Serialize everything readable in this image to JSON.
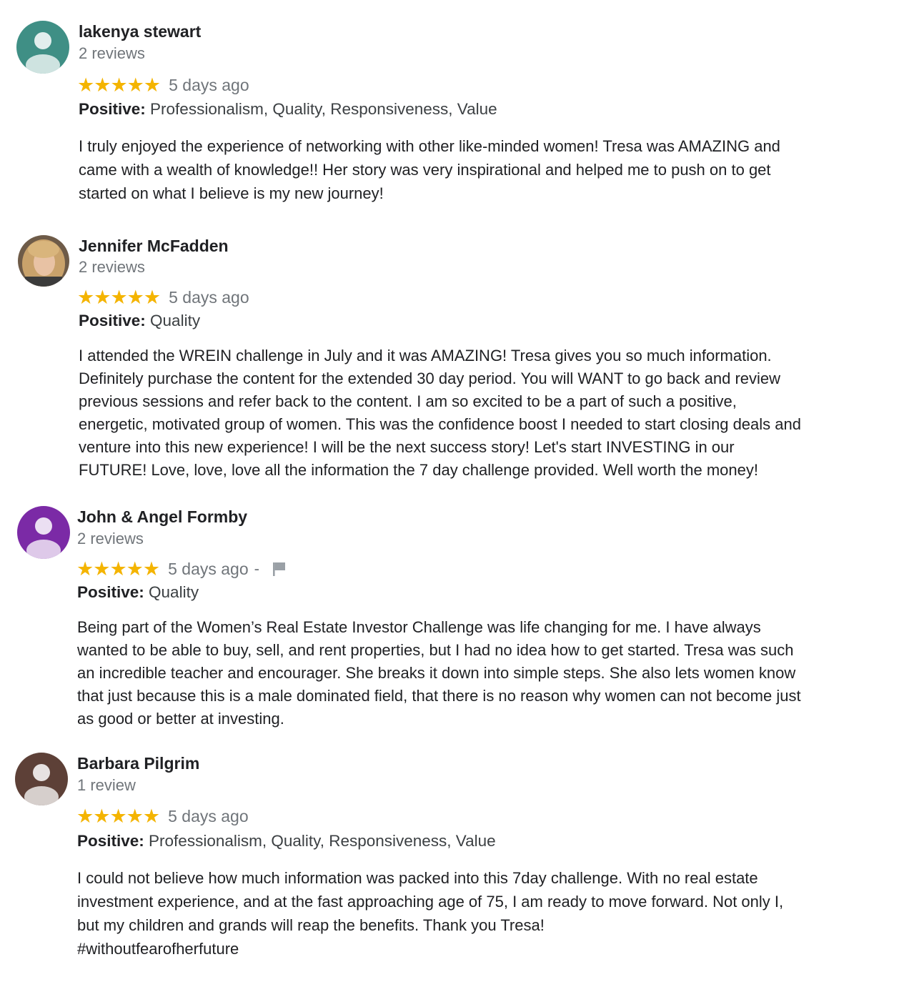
{
  "reviews": [
    {
      "author": "lakenya stewart",
      "review_count": "2 reviews",
      "stars": 5,
      "time": "5 days ago",
      "positive_label": "Positive:",
      "positive_values": "Professionalism, Quality, Responsiveness, Value",
      "avatar_color": "#3f8f85",
      "body_lines": [
        "I truly enjoyed the experience of networking with other like-minded women! Tresa was AMAZING and",
        "came with a wealth of knowledge!! Her story was very inspirational and helped me to push on to get",
        "started on what I believe is my new journey!"
      ]
    },
    {
      "author": "Jennifer McFadden",
      "review_count": "2 reviews",
      "stars": 5,
      "time": "5 days ago",
      "positive_label": "Positive:",
      "positive_values": "Quality",
      "avatar_color": "#8a6a4a",
      "body_lines": [
        "I attended the WREIN challenge in July and it was AMAZING!  Tresa gives you so much information.",
        "Definitely purchase the content for the extended 30 day period.  You will WANT to go back and review",
        "previous sessions and refer back to the content.  I am so excited to be a part of such a positive,",
        "energetic, motivated group of women.  This was the confidence boost I needed to start closing deals and",
        "venture into this new experience!  I will be the next success story!  Let's start INVESTING in our",
        "FUTURE!  Love, love, love all the information the 7 day challenge provided.  Well worth the money!"
      ]
    },
    {
      "author": "John & Angel Formby",
      "review_count": "2 reviews",
      "stars": 5,
      "time": "5 days ago",
      "separator": "-",
      "positive_label": "Positive:",
      "positive_values": "Quality",
      "avatar_color": "#7b2aa6",
      "body_lines": [
        "Being part of the Women’s Real Estate Investor Challenge was life changing for me. I have always",
        "wanted to be able to buy, sell, and rent properties, but I had no idea how to get started. Tresa was such",
        "an incredible teacher and encourager. She breaks it down into simple steps. She also lets women know",
        "that just because this is a male dominated field, that there is no reason why women can not become just",
        "as good or better at investing."
      ]
    },
    {
      "author": "Barbara Pilgrim",
      "review_count": "1 review",
      "stars": 5,
      "time": "5 days ago",
      "positive_label": "Positive:",
      "positive_values": "Professionalism, Quality, Responsiveness, Value",
      "avatar_color": "#5d4037",
      "body_lines": [
        "I could not believe how much information was packed into this 7day challenge. With no real estate",
        "investment experience, and at the fast approaching age of 75, I am ready to move forward. Not only I,",
        "but my children and grands will reap the benefits. Thank you Tresa!",
        "#withoutfearofherfuture"
      ]
    }
  ],
  "colors": {
    "star": "#f4b400",
    "muted_text": "#70757a",
    "flag": "#9aa0a6"
  },
  "icons": {
    "star": "star-icon",
    "flag": "flag-icon",
    "avatar": "person-icon"
  }
}
